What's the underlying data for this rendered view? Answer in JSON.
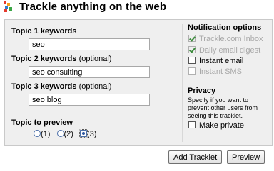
{
  "header": {
    "title": "Trackle anything on the web",
    "logo_icon": "trackle-logo-icon"
  },
  "form": {
    "topic1": {
      "label": "Topic 1 keywords",
      "value": "seo"
    },
    "topic2": {
      "label": "Topic 2 keywords",
      "optional": "(optional)",
      "value": "seo consulting"
    },
    "topic3": {
      "label": "Topic 3 keywords",
      "optional": "(optional)",
      "value": "seo blog"
    },
    "preview": {
      "label": "Topic to preview",
      "options": [
        "(1)",
        "(2)",
        "(3)"
      ],
      "selected": "(3)"
    }
  },
  "notifications": {
    "heading": "Notification options",
    "items": [
      {
        "label": "Trackle.com Inbox",
        "checked": true,
        "disabled": true
      },
      {
        "label": "Daily email digest",
        "checked": true,
        "disabled": true
      },
      {
        "label": "Instant email",
        "checked": false,
        "disabled": false
      },
      {
        "label": "Instant SMS",
        "checked": false,
        "disabled": true
      }
    ]
  },
  "privacy": {
    "heading": "Privacy",
    "description": "Specify if you want to prevent other users from seeing this tracklet.",
    "make_private_label": "Make private",
    "make_private_checked": false
  },
  "buttons": {
    "add": "Add Tracklet",
    "preview": "Preview"
  }
}
